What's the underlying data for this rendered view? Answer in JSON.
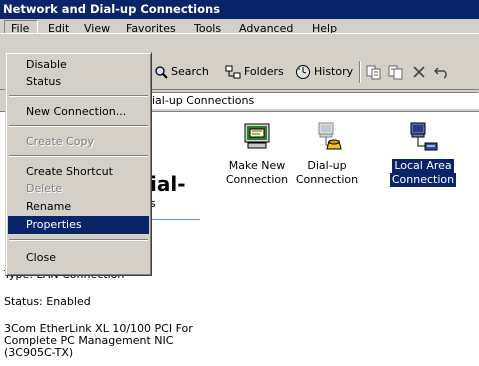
{
  "window": {
    "title": "Network and Dial-up Connections"
  },
  "menubar": {
    "items": [
      "File",
      "Edit",
      "View",
      "Favorites",
      "Tools",
      "Advanced",
      "Help"
    ]
  },
  "toolbar": {
    "search": "Search",
    "folders": "Folders",
    "history": "History"
  },
  "address": {
    "value": "ial-up Connections"
  },
  "file_menu": {
    "items": [
      {
        "label": "Disable",
        "enabled": true
      },
      {
        "label": "Status",
        "enabled": true
      },
      {
        "label": "New Connection...",
        "enabled": true
      },
      {
        "label": "Create Copy",
        "enabled": false
      },
      {
        "label": "Create Shortcut",
        "enabled": true
      },
      {
        "label": "Delete",
        "enabled": false
      },
      {
        "label": "Rename",
        "enabled": true
      },
      {
        "label": "Properties",
        "enabled": true,
        "highlighted": true
      },
      {
        "label": "Close",
        "enabled": true
      }
    ]
  },
  "icons": [
    {
      "line1": "Make New",
      "line2": "Connection"
    },
    {
      "line1": "Dial-up",
      "line2": "Connection"
    },
    {
      "line1": "Local Area",
      "line2": "Connection",
      "selected": true
    }
  ],
  "left_panel": {
    "title_fragment": "ial-",
    "subtitle_fragment": "s",
    "type": "Type: LAN Connection",
    "status": "Status: Enabled",
    "device_line1": "3Com EtherLink XL 10/100 PCI For",
    "device_line2": "Complete PC Management NIC",
    "device_line3": "(3C905C-TX)"
  },
  "colors": {
    "titlebar": "#0a246a",
    "chrome": "#d4d0c8",
    "highlight": "#0a246a"
  }
}
